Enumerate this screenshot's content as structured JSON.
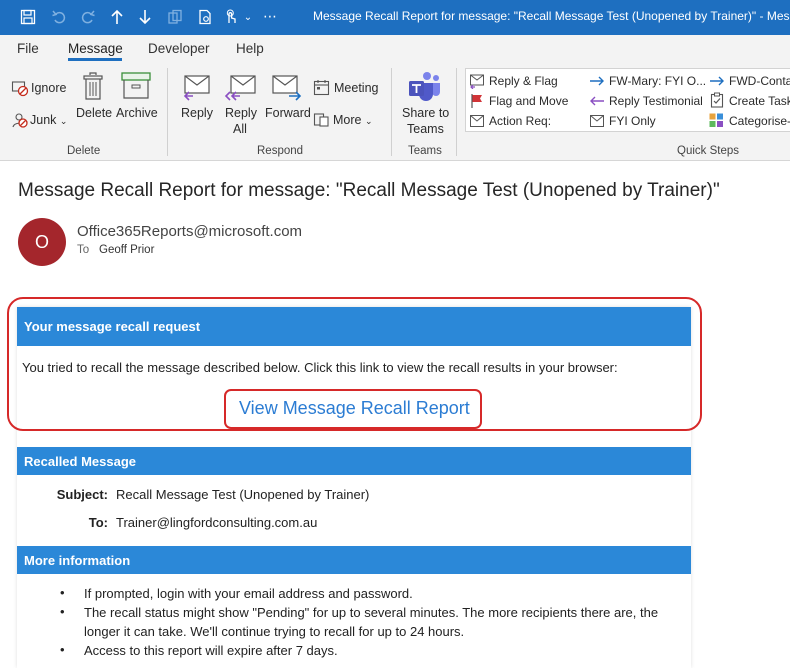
{
  "window": {
    "title": "Message Recall Report for message: \"Recall Message Test (Unopened by Trainer)\"  -  Message"
  },
  "tabs": [
    "File",
    "Message",
    "Developer",
    "Help"
  ],
  "active_tab": "Message",
  "ribbon": {
    "delete_group": {
      "ignore": "Ignore",
      "junk": "Junk",
      "delete": "Delete",
      "archive": "Archive",
      "label": "Delete"
    },
    "respond_group": {
      "reply": "Reply",
      "reply_all_line1": "Reply",
      "reply_all_line2": "All",
      "forward": "Forward",
      "meeting": "Meeting",
      "more": "More",
      "label": "Respond"
    },
    "teams_group": {
      "share_line1": "Share to",
      "share_line2": "Teams",
      "label": "Teams"
    },
    "quick_steps": {
      "label": "Quick Steps",
      "items": [
        "Reply & Flag",
        "FW-Mary: FYI O...",
        "FWD-Conta",
        "Flag and Move",
        "Reply Testimonial",
        "Create Task",
        "Action Req:",
        "FYI Only",
        "Categorise-"
      ]
    }
  },
  "message": {
    "subject": "Message Recall Report for message: \"Recall Message Test (Unopened by Trainer)\"",
    "avatar_initial": "O",
    "sender": "Office365Reports@microsoft.com",
    "to_label": "To",
    "to_name": "Geoff Prior"
  },
  "body": {
    "request_header": "Your message recall request",
    "request_text": "You tried to recall the message described below. Click this link to view the recall results in your browser:",
    "link_text": "View Message Recall Report",
    "recalled_header": "Recalled Message",
    "subject_label": "Subject:",
    "subject_value": "Recall Message Test (Unopened by Trainer)",
    "to_label": "To:",
    "to_value": "Trainer@lingfordconsulting.com.au",
    "more_header": "More information",
    "bullets": [
      "If prompted, login with your email address and password.",
      "The recall status might show \"Pending\" for up to several minutes. The more recipients there are, the longer it can take. We'll continue trying to recall for up to 24 hours.",
      "Access to this report will expire after 7 days."
    ]
  },
  "colors": {
    "title_bar": "#1e6fc0",
    "section_bar": "#2b88d8",
    "link": "#2b7cd3",
    "highlight": "#d62929",
    "avatar": "#a4262c"
  }
}
